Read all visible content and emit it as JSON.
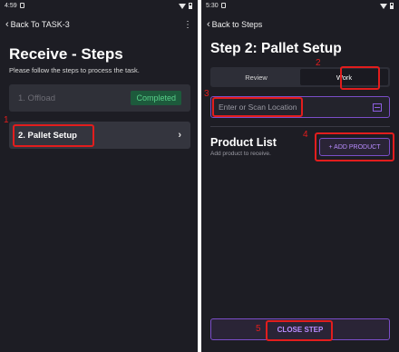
{
  "left": {
    "status": {
      "time": "4:59"
    },
    "back_label": "Back To TASK-3",
    "menu_icon": "more-vert-icon",
    "title": "Receive - Steps",
    "subtitle": "Please follow the steps to process the task.",
    "steps": [
      {
        "label": "1. Offload",
        "status": "Completed"
      },
      {
        "label": "2. Pallet Setup"
      }
    ]
  },
  "right": {
    "status": {
      "time": "5:30"
    },
    "back_label": "Back to Steps",
    "title": "Step 2: Pallet Setup",
    "tabs": [
      {
        "label": "Review",
        "active": false
      },
      {
        "label": "Work",
        "active": true
      }
    ],
    "scan": {
      "placeholder": "Enter or Scan Location",
      "icon": "scan-icon"
    },
    "product_list": {
      "title": "Product List",
      "subtitle": "Add product to receive.",
      "add_button": "+ ADD PRODUCT"
    },
    "close_button": "CLOSE STEP"
  },
  "annotations": [
    "1",
    "2",
    "3",
    "4",
    "5"
  ],
  "colors": {
    "background": "#1d1d24",
    "accent": "#7b4ec8",
    "accent_text": "#b98cff",
    "success_bg": "#1d5a3c",
    "success_text": "#58d08a",
    "annotation": "#e21d1d"
  }
}
